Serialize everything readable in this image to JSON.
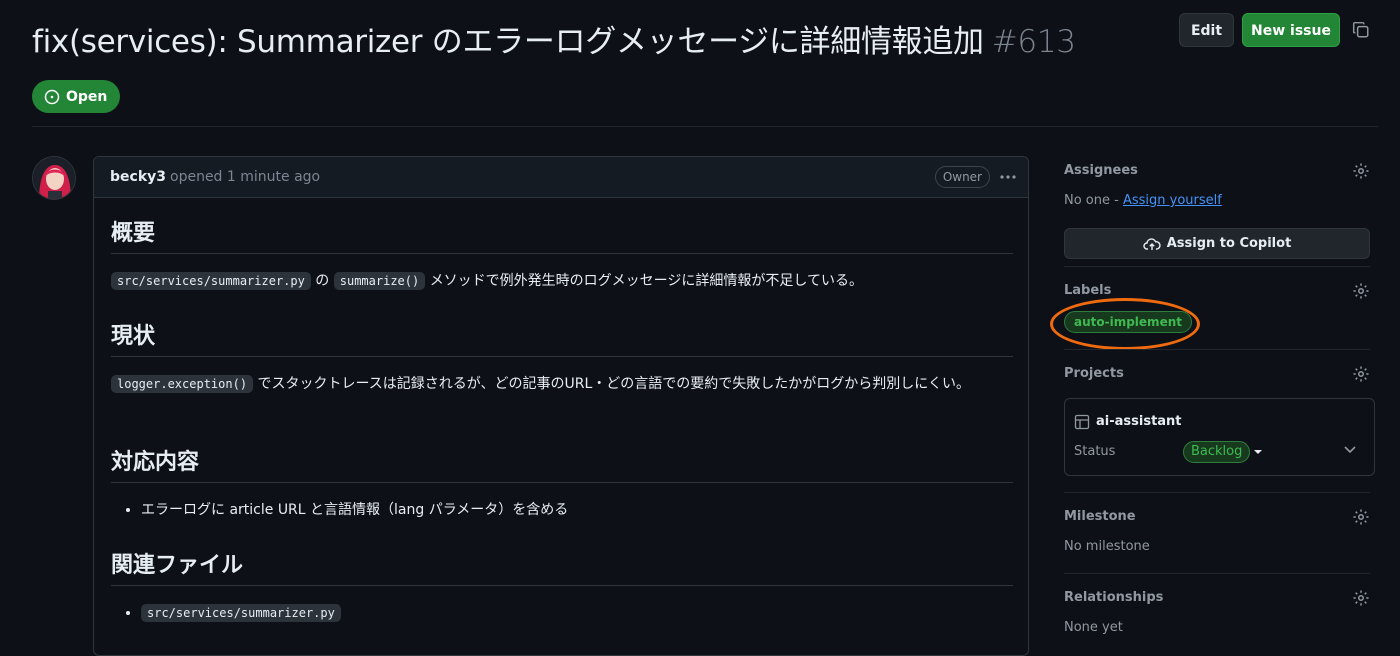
{
  "issue": {
    "title": "fix(services): Summarizer のエラーログメッセージに詳細情報追加",
    "number": "#613",
    "state": "Open"
  },
  "header_actions": {
    "edit_label": "Edit",
    "new_issue_label": "New issue",
    "copy_icon": "copy-icon"
  },
  "comment": {
    "author": "becky3",
    "meta": "opened 1 minute ago",
    "badge": "Owner",
    "sections": [
      {
        "heading": "概要",
        "code1": "src/services/summarizer.py",
        "text1": "の",
        "code2": "summarize()",
        "text2": "メソッドで例外発生時のログメッセージに詳細情報が不足している。"
      },
      {
        "heading": "現状",
        "code1": "logger.exception()",
        "text1": "でスタックトレースは記録されるが、どの記事のURL・どの言語での要約で失敗したかがログから判別しにくい。"
      },
      {
        "heading": "対応内容",
        "items": [
          "エラーログに article URL と言語情報（lang パラメータ）を含める"
        ]
      },
      {
        "heading": "関連ファイル",
        "items": [
          "src/services/summarizer.py"
        ]
      }
    ]
  },
  "sidebar": {
    "assignees": {
      "title": "Assignees",
      "none_text": "No one - ",
      "assign_link": "Assign yourself",
      "copilot_button": "Assign to Copilot"
    },
    "labels": {
      "title": "Labels",
      "items": [
        "auto-implement"
      ]
    },
    "projects": {
      "title": "Projects",
      "project_name": "ai-assistant",
      "status_label": "Status",
      "status_value": "Backlog"
    },
    "milestone": {
      "title": "Milestone",
      "value": "No milestone"
    },
    "relationships": {
      "title": "Relationships",
      "value": "None yet"
    }
  },
  "colors": {
    "background": "#0d1117",
    "open_green": "#238636",
    "label_green": "#3fb950",
    "annotation_orange": "#f06a0f",
    "link_blue": "#4493f8"
  }
}
